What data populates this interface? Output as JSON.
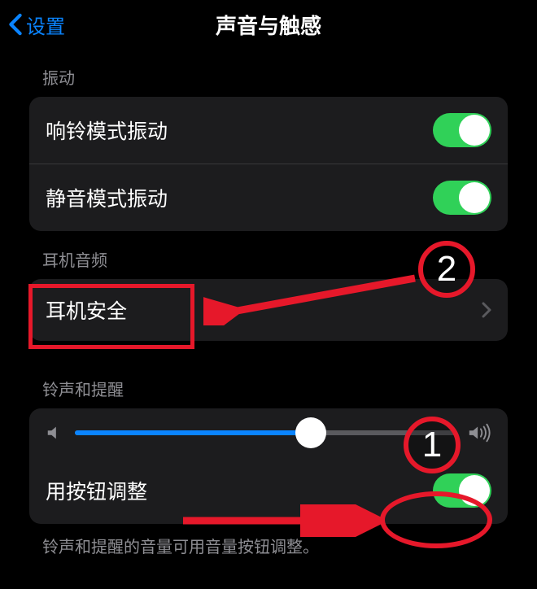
{
  "header": {
    "back_label": "设置",
    "title": "声音与触感"
  },
  "sections": {
    "vibration": {
      "header": "振动",
      "ring_vibrate_label": "响铃模式振动",
      "ring_vibrate_on": true,
      "silent_vibrate_label": "静音模式振动",
      "silent_vibrate_on": true
    },
    "headphone": {
      "header": "耳机音频",
      "safety_label": "耳机安全"
    },
    "ringer": {
      "header": "铃声和提醒",
      "slider_value": 62,
      "button_adjust_label": "用按钮调整",
      "button_adjust_on": true,
      "footer": "铃声和提醒的音量可用音量按钮调整。"
    }
  },
  "annotations": {
    "marker1": "1",
    "marker2": "2"
  }
}
